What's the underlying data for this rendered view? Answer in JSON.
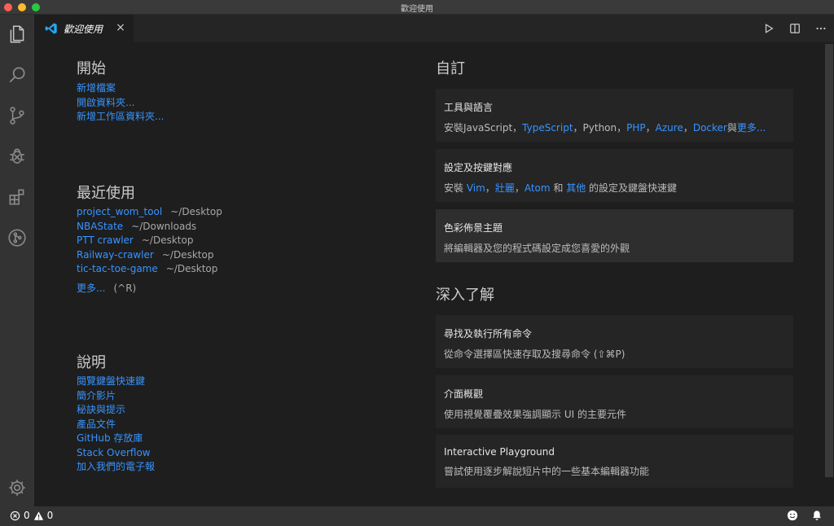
{
  "window": {
    "title": "歡迎使用"
  },
  "tab": {
    "label": "歡迎使用",
    "close": "×"
  },
  "start": {
    "heading": "開始",
    "links": [
      "新增檔案",
      "開啟資料夾...",
      "新增工作區資料夾..."
    ]
  },
  "recent": {
    "heading": "最近使用",
    "items": [
      {
        "name": "project_wom_tool",
        "path": "~/Desktop"
      },
      {
        "name": "NBAState",
        "path": "~/Downloads"
      },
      {
        "name": "PTT crawler",
        "path": "~/Desktop"
      },
      {
        "name": "Railway-crawler",
        "path": "~/Desktop"
      },
      {
        "name": "tic-tac-toe-game",
        "path": "~/Desktop"
      }
    ],
    "more_label": "更多...",
    "more_shortcut": "(^R)"
  },
  "help": {
    "heading": "說明",
    "links": [
      "閱覽鍵盤快速鍵",
      "簡介影片",
      "秘訣與提示",
      "產品文件",
      "GitHub 存放庫",
      "Stack Overflow",
      "加入我們的電子報"
    ]
  },
  "customize": {
    "heading": "自訂",
    "tools": {
      "title": "工具與語言",
      "prefix": "安裝JavaScript，",
      "typescript": "TypeScript",
      "sep1": "，Python，",
      "php": "PHP",
      "sep2": "，",
      "azure": "Azure",
      "sep3": "，",
      "docker": "Docker",
      "sep4": "與",
      "more": "更多..."
    },
    "keymaps": {
      "title": "設定及按鍵對應",
      "prefix": "安裝 ",
      "vim": "Vim",
      "sep1": "，",
      "sublime": "壯麗",
      "sep2": "，",
      "atom": "Atom",
      "sep3": " 和 ",
      "other": "其他",
      "suffix": " 的設定及鍵盤快速鍵"
    },
    "theme": {
      "title": "色彩佈景主題",
      "desc": "將編輯器及您的程式碼設定成您喜愛的外觀"
    }
  },
  "learn": {
    "heading": "深入了解",
    "cards": [
      {
        "title": "尋找及執行所有命令",
        "desc": "從命令選擇區快速存取及搜尋命令 (⇧⌘P)"
      },
      {
        "title": "介面概觀",
        "desc": "使用視覺覆疊效果強調顯示 UI 的主要元件"
      },
      {
        "title": "Interactive Playground",
        "desc": "嘗試使用逐步解說短片中的一些基本編輯器功能"
      }
    ]
  },
  "status": {
    "errors": "0",
    "warnings": "0"
  },
  "colors": {
    "link": "#3794ff",
    "editor_bg": "#1e1e1e",
    "activity_bar": "#333333",
    "vscode_blue": "#23a9f2"
  },
  "icons": [
    "files-icon",
    "search-icon",
    "source-control-icon",
    "debug-icon",
    "extensions-icon",
    "git-graph-icon",
    "gear-icon",
    "run-icon",
    "split-editor-icon",
    "more-actions-icon",
    "error-icon",
    "warning-icon",
    "smiley-icon",
    "bell-icon"
  ]
}
